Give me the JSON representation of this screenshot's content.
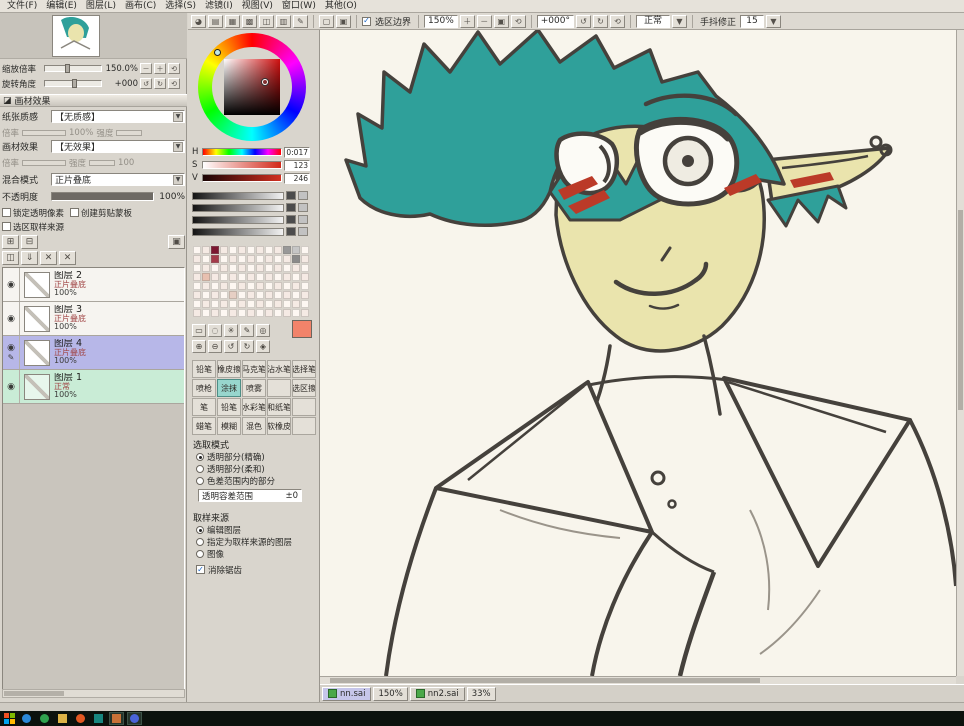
{
  "colors": {
    "hair": "#2fa09a",
    "skin": "#eae4ad",
    "line": "#45413c",
    "mark": "#bb3a28",
    "paper": "#f8f5ec",
    "accent_selected": "#b7b7e8",
    "accent_layer1": "#c9ecd6",
    "current": "#f2836a"
  },
  "icons": {
    "check": "✓",
    "down": "▼",
    "minus": "－",
    "plus": "＋",
    "reset": "⟲",
    "fit": "▣",
    "rot_l": "↺",
    "rot_r": "↻",
    "eye": "◉",
    "pen": "✎",
    "section": "◪",
    "new_layer": "⊞",
    "new_folder": "⊟",
    "dup": "◫",
    "merge": "⇓",
    "del": "✕",
    "window": "▢",
    "toggles": [
      "◕",
      "▤",
      "▦",
      "▩",
      "◫",
      "▥",
      "✎"
    ],
    "tools1": [
      "▭",
      "◌",
      "✳",
      "✎",
      "◎"
    ],
    "tools2": [
      "⊕",
      "⊖",
      "↺",
      "↻",
      "◈"
    ]
  },
  "menubar": {
    "items": [
      "文件(F)",
      "编辑(E)",
      "图层(L)",
      "画布(C)",
      "选择(S)",
      "滤镜(I)",
      "视图(V)",
      "窗口(W)",
      "其他(O)"
    ]
  },
  "toolbar": {
    "selection_border": "选区边界",
    "zoom": "150%",
    "angle": "+000°",
    "mode": "正常",
    "stabilizer_label": "手抖修正",
    "stabilizer_value": "15"
  },
  "navigator": {
    "zoom_label": "缩放倍率",
    "zoom_value": "150.0%",
    "angle_label": "旋转角度",
    "angle_value": "+000"
  },
  "material": {
    "title": "画材效果",
    "texture_label": "纸张质感",
    "texture_value": "【无质感】",
    "scale_label": "倍率",
    "scale_value": "100%",
    "strength_label": "强度",
    "strength_value": "100",
    "effect_label": "画材效果",
    "effect_value": "【无效果】"
  },
  "layer_props": {
    "blend_label": "混合模式",
    "blend_value": "正片叠底",
    "opacity_label": "不透明度",
    "opacity_value": "100%",
    "lock_label": "锁定透明像素",
    "clip_label": "创建剪贴蒙板",
    "sel_src_label": "选区取样来源"
  },
  "layers": [
    {
      "name": "图层 2",
      "mode": "正片叠底",
      "opacity": "100%"
    },
    {
      "name": "图层 3",
      "mode": "正片叠底",
      "opacity": "100%"
    },
    {
      "name": "图层 4",
      "mode": "正片叠底",
      "opacity": "100%"
    },
    {
      "name": "图层 1",
      "mode": "正常",
      "opacity": "100%"
    }
  ],
  "color": {
    "h_label": "H",
    "h_value": "0:017",
    "s_label": "S",
    "s_value": "123",
    "v_label": "V",
    "v_value": "246"
  },
  "swatches": {
    "rows": 8,
    "cols": 13,
    "base1": "#f5eae4",
    "base2": "#fdf7f2",
    "special": [
      {
        "r": 0,
        "c": 2,
        "color": "#7c1630"
      },
      {
        "r": 1,
        "c": 2,
        "color": "#a43a4a"
      },
      {
        "r": 0,
        "c": 10,
        "color": "#989898"
      },
      {
        "r": 0,
        "c": 11,
        "color": "#c6c6c6"
      },
      {
        "r": 1,
        "c": 11,
        "color": "#8a8a8a"
      },
      {
        "r": 3,
        "c": 1,
        "color": "#e8c0b0"
      },
      {
        "r": 5,
        "c": 4,
        "color": "#e6cfc4"
      }
    ]
  },
  "tools": {
    "grid": [
      [
        "铅笔",
        "橡皮擦",
        "马克笔",
        "沾水笔",
        "选择笔"
      ],
      [
        "喷枪",
        "涂抹",
        "喷雾",
        "",
        "选区擦"
      ],
      [
        "笔",
        "铅笔",
        "水彩笔",
        "和纸笔",
        ""
      ],
      [
        "蜡笔",
        "模糊",
        "混色",
        "软橡皮",
        ""
      ]
    ]
  },
  "selection_mode": {
    "title": "选取模式",
    "options": [
      "透明部分(精确)",
      "透明部分(柔和)",
      "色差范围内的部分"
    ],
    "tolerance_label": "透明容差范围",
    "tolerance_value": "±0"
  },
  "sampling": {
    "title": "取样来源",
    "options": [
      "编辑图层",
      "指定为取样来源的图层",
      "图像"
    ],
    "antialias_label": "消除锯齿"
  },
  "statusbar": {
    "files": [
      {
        "name": "nn.sai",
        "zoom": "150%"
      },
      {
        "name": "nn2.sai",
        "zoom": "33%"
      }
    ]
  },
  "taskbar": {
    "start_colors": [
      "#f25022",
      "#7fba00",
      "#00a4ef",
      "#ffb900"
    ],
    "icons": [
      {
        "color": "#2b88d8",
        "shape": "circle"
      },
      {
        "color": "#30a14e",
        "shape": "circle"
      },
      {
        "color": "#ddb347",
        "shape": "square"
      },
      {
        "color": "#e25822",
        "shape": "circle"
      },
      {
        "color": "#18867f",
        "shape": "square"
      },
      {
        "color": "#c87137",
        "shape": "square",
        "highlight": true
      },
      {
        "color": "#4a64d8",
        "shape": "circle",
        "highlight": true
      }
    ]
  }
}
